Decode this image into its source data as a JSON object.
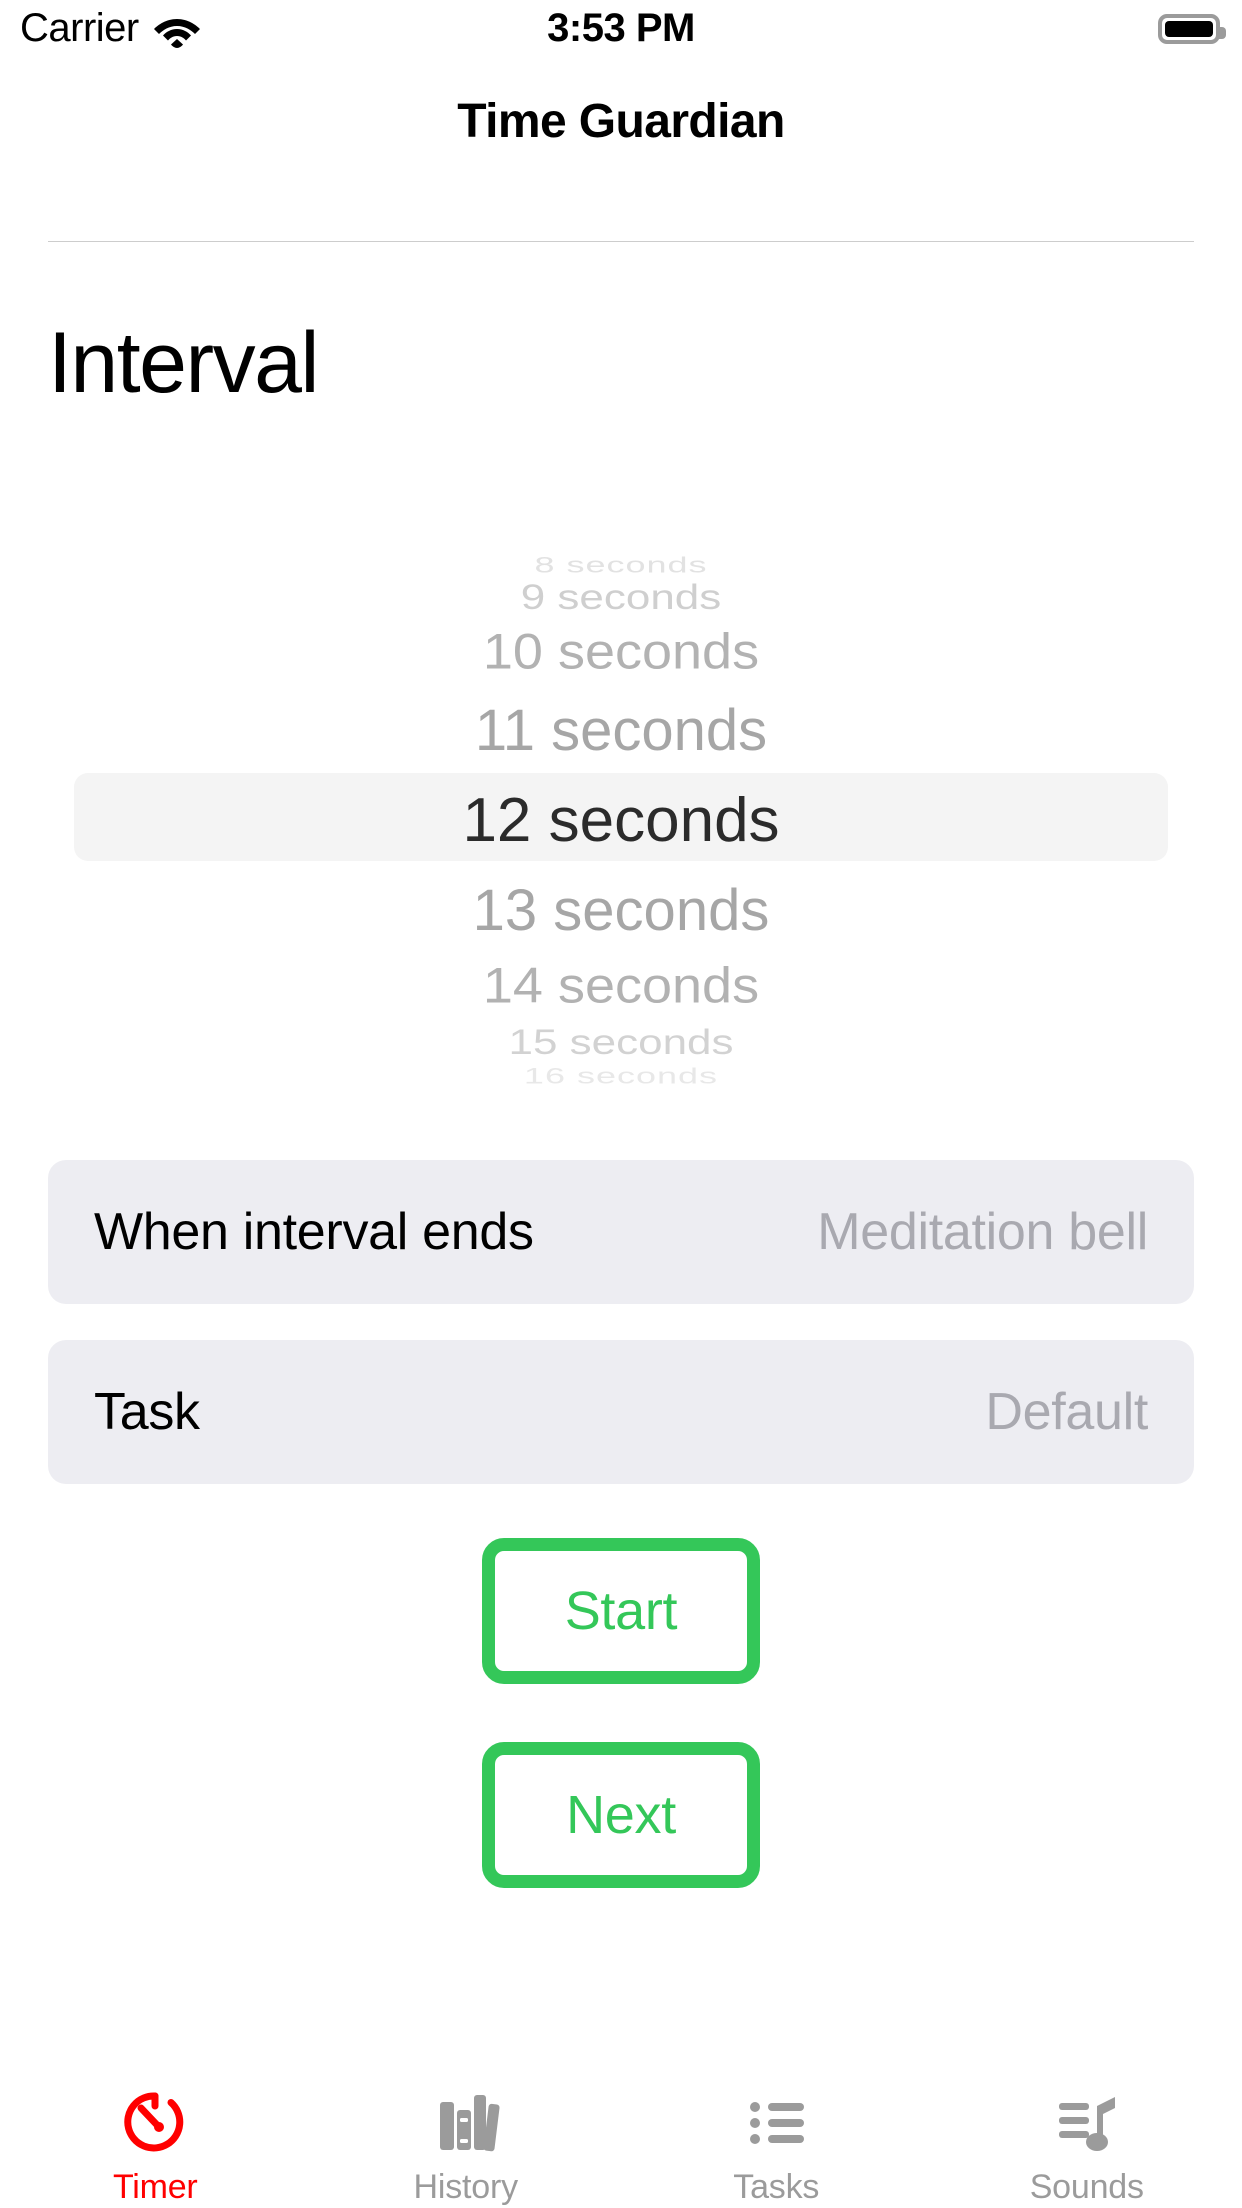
{
  "status_bar": {
    "carrier": "Carrier",
    "time": "3:53 PM",
    "wifi_icon": "wifi-icon",
    "battery_icon": "battery-full-icon"
  },
  "nav": {
    "title": "Time Guardian"
  },
  "page": {
    "heading": "Interval"
  },
  "picker": {
    "name": "interval-picker",
    "selected_index": 4,
    "selected_value": "12 seconds",
    "options": [
      "8 seconds",
      "9 seconds",
      "10 seconds",
      "11 seconds",
      "12 seconds",
      "13 seconds",
      "14 seconds",
      "15 seconds",
      "16 seconds"
    ]
  },
  "settings": {
    "rows": [
      {
        "label": "When interval ends",
        "value": "Meditation bell"
      },
      {
        "label": "Task",
        "value": "Default"
      }
    ]
  },
  "actions": {
    "start_label": "Start",
    "next_label": "Next"
  },
  "tabbar": {
    "items": [
      {
        "label": "Timer",
        "icon": "stopwatch-icon",
        "active": true
      },
      {
        "label": "History",
        "icon": "books-icon",
        "active": false
      },
      {
        "label": "Tasks",
        "icon": "list-icon",
        "active": false
      },
      {
        "label": "Sounds",
        "icon": "music-note-icon",
        "active": false
      }
    ]
  },
  "colors": {
    "accent_green": "#34C759",
    "active_tab_red": "#FF0000",
    "row_background": "#EDEDF2",
    "picker_highlight": "#F4F4F4",
    "inactive_gray": "#9B9B9B"
  }
}
